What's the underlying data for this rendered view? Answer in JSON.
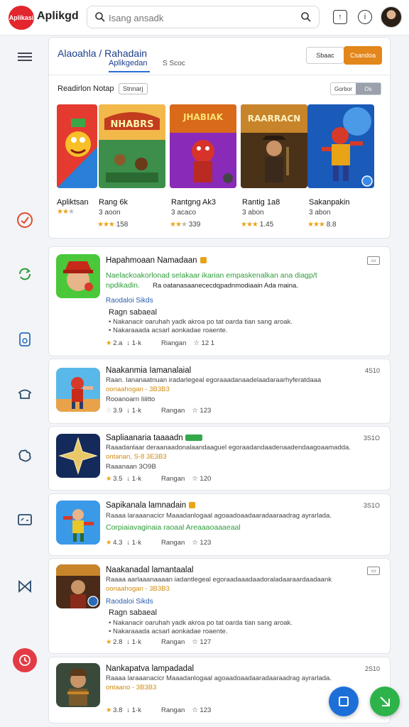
{
  "topbar": {
    "logo_badge": "Aplikasi",
    "logo_text": "Aplikgd",
    "search_placeholder": "Isang ansadk",
    "icons": [
      "search-icon",
      "upload-icon",
      "info-icon",
      "avatar"
    ]
  },
  "rail": {
    "icons": [
      "menu-icon",
      "speedometer-icon",
      "refresh-icon",
      "phone-icon",
      "hat-icon",
      "puzzle-icon",
      "screen-icon",
      "butterfly-icon",
      "clock-icon"
    ]
  },
  "featured": {
    "title": "Alaoahla  /  Rahadain",
    "tab_active": "Aplikgedan",
    "tab_other": "S  Scoc",
    "btn_ghost": "Sbaac",
    "btn_primary": "Csandoa",
    "section_label": "Readirlon Notap",
    "section_chip": "Stnnarj",
    "section_right_a": "Gorbor",
    "section_right_b": "Os",
    "games": [
      {
        "name": "Apliktsan",
        "sub": "",
        "stars": "2",
        "count": ""
      },
      {
        "name": "Rang 6k",
        "sub": "3 aoon",
        "stars": "3",
        "count": "158"
      },
      {
        "name": "Rantgng Ak3",
        "sub": "3 acaco",
        "stars": "3",
        "count": "339"
      },
      {
        "name": "Rantig 1a8",
        "sub": "3 abon",
        "stars": "3",
        "count": "1.45"
      },
      {
        "name": "Sakanpakin",
        "sub": "3 abon",
        "stars": "3",
        "count": "8.8"
      }
    ]
  },
  "cards": [
    {
      "title": "Hapahmoaan Namadaan",
      "green1": "Naelackoakorlonad selakaar  ikarian empaskenalkan ana diagp/t",
      "green2": "npdikadin.",
      "desc1": "Ra  oatanasaanececdqpadnmodiaain  Ada maina.",
      "blue": "Raodaloi  Sikds",
      "bullet_title": "Ragn  sabaeal",
      "bullet1": "Nakanacir  oaruhah  yadk akroa  po tat oarda tian  sang  aroak.",
      "bullet2": "Nakaraaada acsarl aonkadae  roaente.",
      "rating": "2.a",
      "meta2": "Riangan",
      "meta3": "12 1",
      "right": ""
    },
    {
      "title": "Naakanmia  Iamanalaial",
      "line1": "Raan. Iananaatnuan iradarlegeal egoraaadanaadelaadaraarhyferatdaaa",
      "orange": "oonaahogan - 3B3B3",
      "line2": "Rooanoarn  Iiiitto",
      "rating": "3.9",
      "meta2": "Rangan",
      "meta3": "123",
      "right": "4S10"
    },
    {
      "title": "Sapliaanaria  taaaadn",
      "line1": "Raaadanlaar deraanaadonalaandaaguel egoraadandaadenaadendaagoaamadda.",
      "orange": "ontanan, S-8  3E3B3",
      "line2": "Raaanaan  3O9B",
      "rating": "3.5",
      "meta2": "Rangan",
      "meta3": "120",
      "right": "3S1O"
    },
    {
      "title": "Sapikanala  lamnadain",
      "line1": "Raaaa laraaanacicr Maaadanlogaal agoaadoaadaaradaaraadrag ayrarlada.",
      "green": "Corpiaiavaginaia raoaal  Areaaaoaaaeaal",
      "rating": "4.3",
      "meta2": "Rangan",
      "meta3": "123",
      "right": "3S1O"
    },
    {
      "title": "Naakanadal  lamantaalal",
      "line1": "Raaaa aarlaaanaaaan iadantlegeal egoraadaaadaadoraladaaraardaadaank",
      "orange": "oonaahogan - 3B3B3",
      "blue": "Raodaloi  Sikds",
      "bullet_title": "Ragn  sabaeal",
      "bullet1": "Nakanacir  oaruhah  yadk akroa  po tat oarda tian  sang  aroak.",
      "bullet2": "Nakaraaada acsarl aonkadae  roaente.",
      "rating": "2.8",
      "meta2": "Rangan",
      "meta3": "127",
      "right": ""
    },
    {
      "title": "Nankapatva  lampadadal",
      "line1": "Raaaa laraaanacicr Maaadanlogaal agoaadoaadaaradaaraadrag ayrarlada.",
      "orange": "ontaano - 3B3B3",
      "rating": "3.8",
      "meta2": "Rangan",
      "meta3": "123",
      "right": "2S10"
    }
  ]
}
